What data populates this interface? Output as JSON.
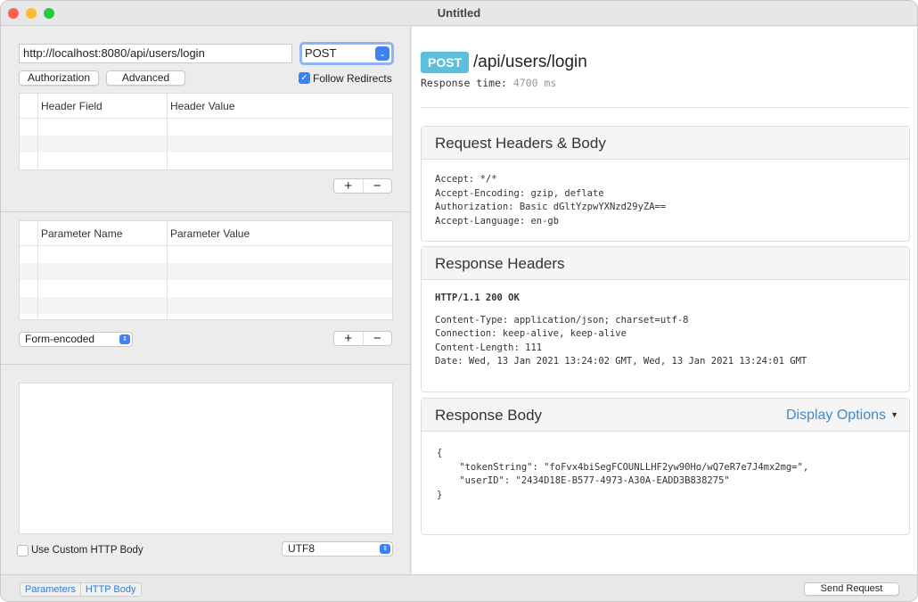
{
  "window": {
    "title": "Untitled"
  },
  "request": {
    "url": "http://localhost:8080/api/users/login",
    "method": "POST",
    "authorization_label": "Authorization",
    "advanced_label": "Advanced",
    "follow_redirects_label": "Follow Redirects",
    "follow_redirects": true,
    "headers_table": {
      "col1": "Header Field",
      "col2": "Header Value"
    },
    "params_table": {
      "col1": "Parameter Name",
      "col2": "Parameter Value"
    },
    "plus": "+",
    "minus": "−",
    "encoding_select": "Form-encoded",
    "custom_body_label": "Use Custom HTTP Body",
    "custom_body": false,
    "charset_select": "UTF8"
  },
  "response": {
    "method_badge": "POST",
    "path": "/api/users/login",
    "time_label": "Response time:",
    "time_value": "4700 ms",
    "request_section": {
      "title": "Request Headers & Body",
      "lines": [
        "Accept: */*",
        "Accept-Encoding: gzip, deflate",
        "Authorization: Basic dGltYzpwYXNzd29yZA==",
        "Accept-Language: en-gb"
      ]
    },
    "headers_section": {
      "title": "Response Headers",
      "status": "HTTP/1.1 200 OK",
      "lines": [
        "Content-Type: application/json; charset=utf-8",
        "Connection: keep-alive, keep-alive",
        "Content-Length: 111",
        "Date: Wed, 13 Jan 2021 13:24:02 GMT, Wed, 13 Jan 2021 13:24:01 GMT"
      ]
    },
    "body_section": {
      "title": "Response Body",
      "display_options": "Display Options",
      "body": "{\n    \"tokenString\": \"foFvx4biSegFCOUNLLHF2yw90Ho/wQ7eR7e7J4mx2mg=\",\n    \"userID\": \"2434D18E-B577-4973-A30A-EADD3B838275\"\n}"
    }
  },
  "bottom": {
    "tabs": [
      "Parameters",
      "HTTP Body"
    ],
    "send_label": "Send Request"
  },
  "colors": {
    "accent": "#3b82f6",
    "badge": "#5bc0de",
    "link": "#428bca"
  }
}
